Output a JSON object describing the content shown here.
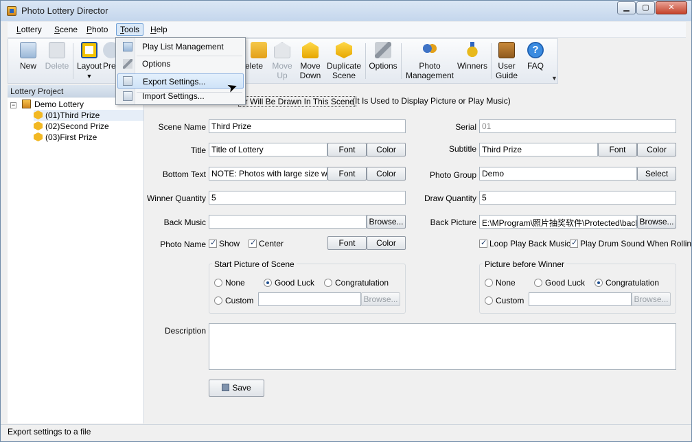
{
  "window": {
    "title": "Photo Lottery Director"
  },
  "menu": [
    {
      "label": "Lottery",
      "mnemonic": "L",
      "rest": "ottery"
    },
    {
      "label": "Scene",
      "mnemonic": "S",
      "rest": "cene"
    },
    {
      "label": "Photo",
      "mnemonic": "P",
      "rest": "hoto"
    },
    {
      "label": "Tools",
      "mnemonic": "T",
      "rest": "ools"
    },
    {
      "label": "Help",
      "mnemonic": "H",
      "rest": "elp"
    }
  ],
  "toolbar": {
    "new": "New",
    "delete": "Delete",
    "layout": "Layout",
    "preview": "Pre",
    "delete_scene": "elete",
    "move_up_1": "Move",
    "move_up_2": "Up",
    "move_down_1": "Move",
    "move_down_2": "Down",
    "duplicate_1": "Duplicate",
    "duplicate_2": "Scene",
    "options": "Options",
    "photo_mgmt_1": "Photo",
    "photo_mgmt_2": "Management",
    "winners": "Winners",
    "user_guide_1": "User",
    "user_guide_2": "Guide",
    "faq": "FAQ"
  },
  "tools_menu": {
    "items": [
      "Play List Management",
      "Options",
      "Export Settings...",
      "Import Settings..."
    ]
  },
  "left_panel": {
    "title": "Lottery Project",
    "root": "Demo Lottery",
    "scenes": [
      "(01)Third Prize",
      "(02)Second Prize",
      "(03)First Prize"
    ]
  },
  "form": {
    "header_text": "er Will Be Drawn In This Scene",
    "header_note": "(It Is Used to Display Picture or Play Music)",
    "scene_name_label": "Scene Name",
    "scene_name": "Third Prize",
    "serial_label": "Serial",
    "serial": "01",
    "title_label": "Title",
    "title": "Title of Lottery",
    "subtitle_label": "Subtitle",
    "subtitle": "Third Prize",
    "bottom_text_label": "Bottom Text",
    "bottom_text": "NOTE: Photos with large size will ma",
    "photo_group_label": "Photo Group",
    "photo_group": "Demo",
    "winner_qty_label": "Winner Quantity",
    "winner_qty": "5",
    "draw_qty_label": "Draw Quantity",
    "draw_qty": "5",
    "back_music_label": "Back Music",
    "back_music": "",
    "back_picture_label": "Back Picture",
    "back_picture": "E:\\MProgram\\照片抽奖软件\\Protected\\back.jp",
    "photo_name_label": "Photo Name",
    "show": "Show",
    "center": "Center",
    "loop_music": "Loop Play Back Music",
    "drum_sound": "Play Drum Sound When Rolling P",
    "start_picture_title": "Start Picture of Scene",
    "picture_before_title": "Picture before Winner",
    "opt_none": "None",
    "opt_good_luck": "Good Luck",
    "opt_congrats": "Congratulation",
    "opt_custom": "Custom",
    "description_label": "Description",
    "font": "Font",
    "color": "Color",
    "select": "Select",
    "browse": "Browse...",
    "save": "Save"
  },
  "status": "Export settings to a file"
}
